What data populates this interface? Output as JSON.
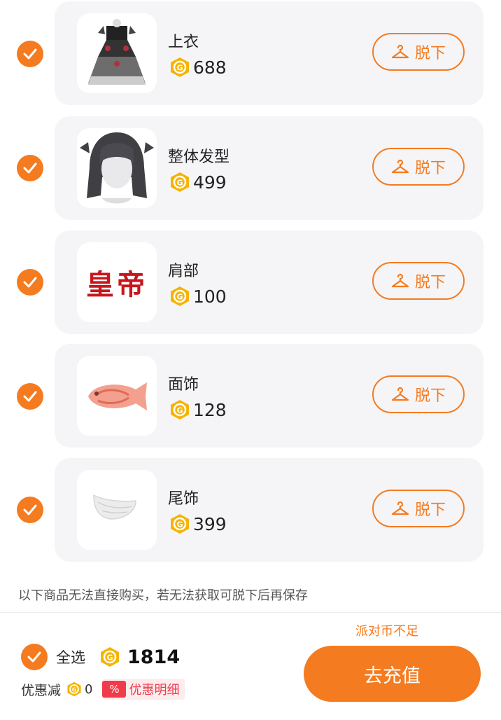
{
  "items": [
    {
      "name": "上衣",
      "price": "688",
      "thumb": "dress"
    },
    {
      "name": "整体发型",
      "price": "499",
      "thumb": "hair"
    },
    {
      "name": "肩部",
      "price": "100",
      "thumb": "emperor-text",
      "thumb_text": "皇帝"
    },
    {
      "name": "面饰",
      "price": "128",
      "thumb": "fish"
    },
    {
      "name": "尾饰",
      "price": "399",
      "thumb": "feather"
    }
  ],
  "takeoff_label": "脱下",
  "notice": "以下商品无法直接购买，若无法获取可脱下后再保存",
  "footer": {
    "insufficient": "派对币不足",
    "select_all": "全选",
    "total": "1814",
    "discount_label": "优惠减",
    "discount_value": "0",
    "detail_badge": "%",
    "detail_label": "优惠明细",
    "recharge_label": "去充值"
  },
  "colors": {
    "accent": "#f47b20",
    "coin": "#f5b400",
    "discount_red": "#ef3b4a",
    "card_bg": "#f5f5f7"
  }
}
